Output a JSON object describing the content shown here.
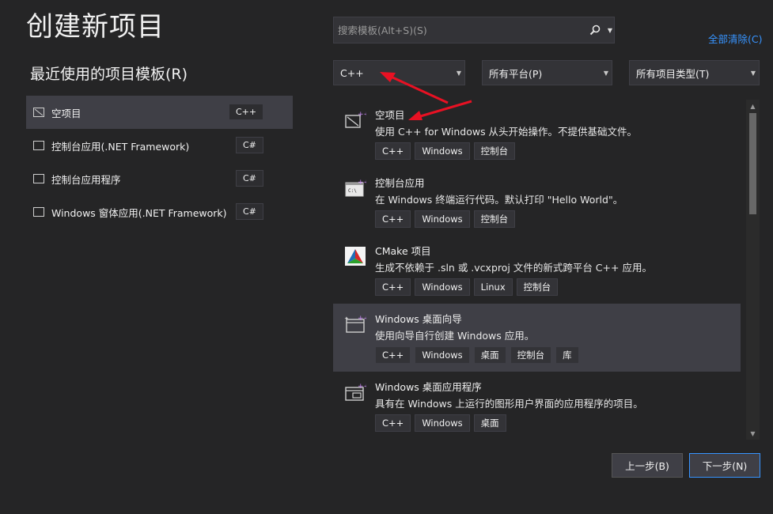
{
  "header": {
    "title": "创建新项目",
    "search_placeholder": "搜索模板(Alt+S)(S)",
    "clear_all": "全部清除(C)"
  },
  "recent": {
    "title": "最近使用的项目模板(R)",
    "items": [
      {
        "label": "空项目",
        "lang": "C++"
      },
      {
        "label": "控制台应用(.NET Framework)",
        "lang": "C#"
      },
      {
        "label": "控制台应用程序",
        "lang": "C#"
      },
      {
        "label": "Windows 窗体应用(.NET Framework)",
        "lang": "C#"
      }
    ]
  },
  "filters": {
    "language": "C++",
    "platform": "所有平台(P)",
    "project_type": "所有项目类型(T)"
  },
  "templates": [
    {
      "name": "空项目",
      "desc": "使用 C++ for Windows 从头开始操作。不提供基础文件。",
      "tags": [
        "C++",
        "Windows",
        "控制台"
      ]
    },
    {
      "name": "控制台应用",
      "desc": "在 Windows 终端运行代码。默认打印 \"Hello World\"。",
      "tags": [
        "C++",
        "Windows",
        "控制台"
      ]
    },
    {
      "name": "CMake 项目",
      "desc": "生成不依赖于 .sln 或 .vcxproj 文件的新式跨平台 C++ 应用。",
      "tags": [
        "C++",
        "Windows",
        "Linux",
        "控制台"
      ]
    },
    {
      "name": "Windows 桌面向导",
      "desc": "使用向导自行创建 Windows 应用。",
      "tags": [
        "C++",
        "Windows",
        "桌面",
        "控制台",
        "库"
      ]
    },
    {
      "name": "Windows 桌面应用程序",
      "desc": "具有在 Windows 上运行的图形用户界面的应用程序的项目。",
      "tags": [
        "C++",
        "Windows",
        "桌面"
      ]
    }
  ],
  "footer": {
    "back_label": "上一步(B)",
    "next_label": "下一步(N)"
  },
  "colors": {
    "background": "#252526",
    "selected": "#3f3f46",
    "link": "#3794ff",
    "arrow": "#e81123"
  }
}
